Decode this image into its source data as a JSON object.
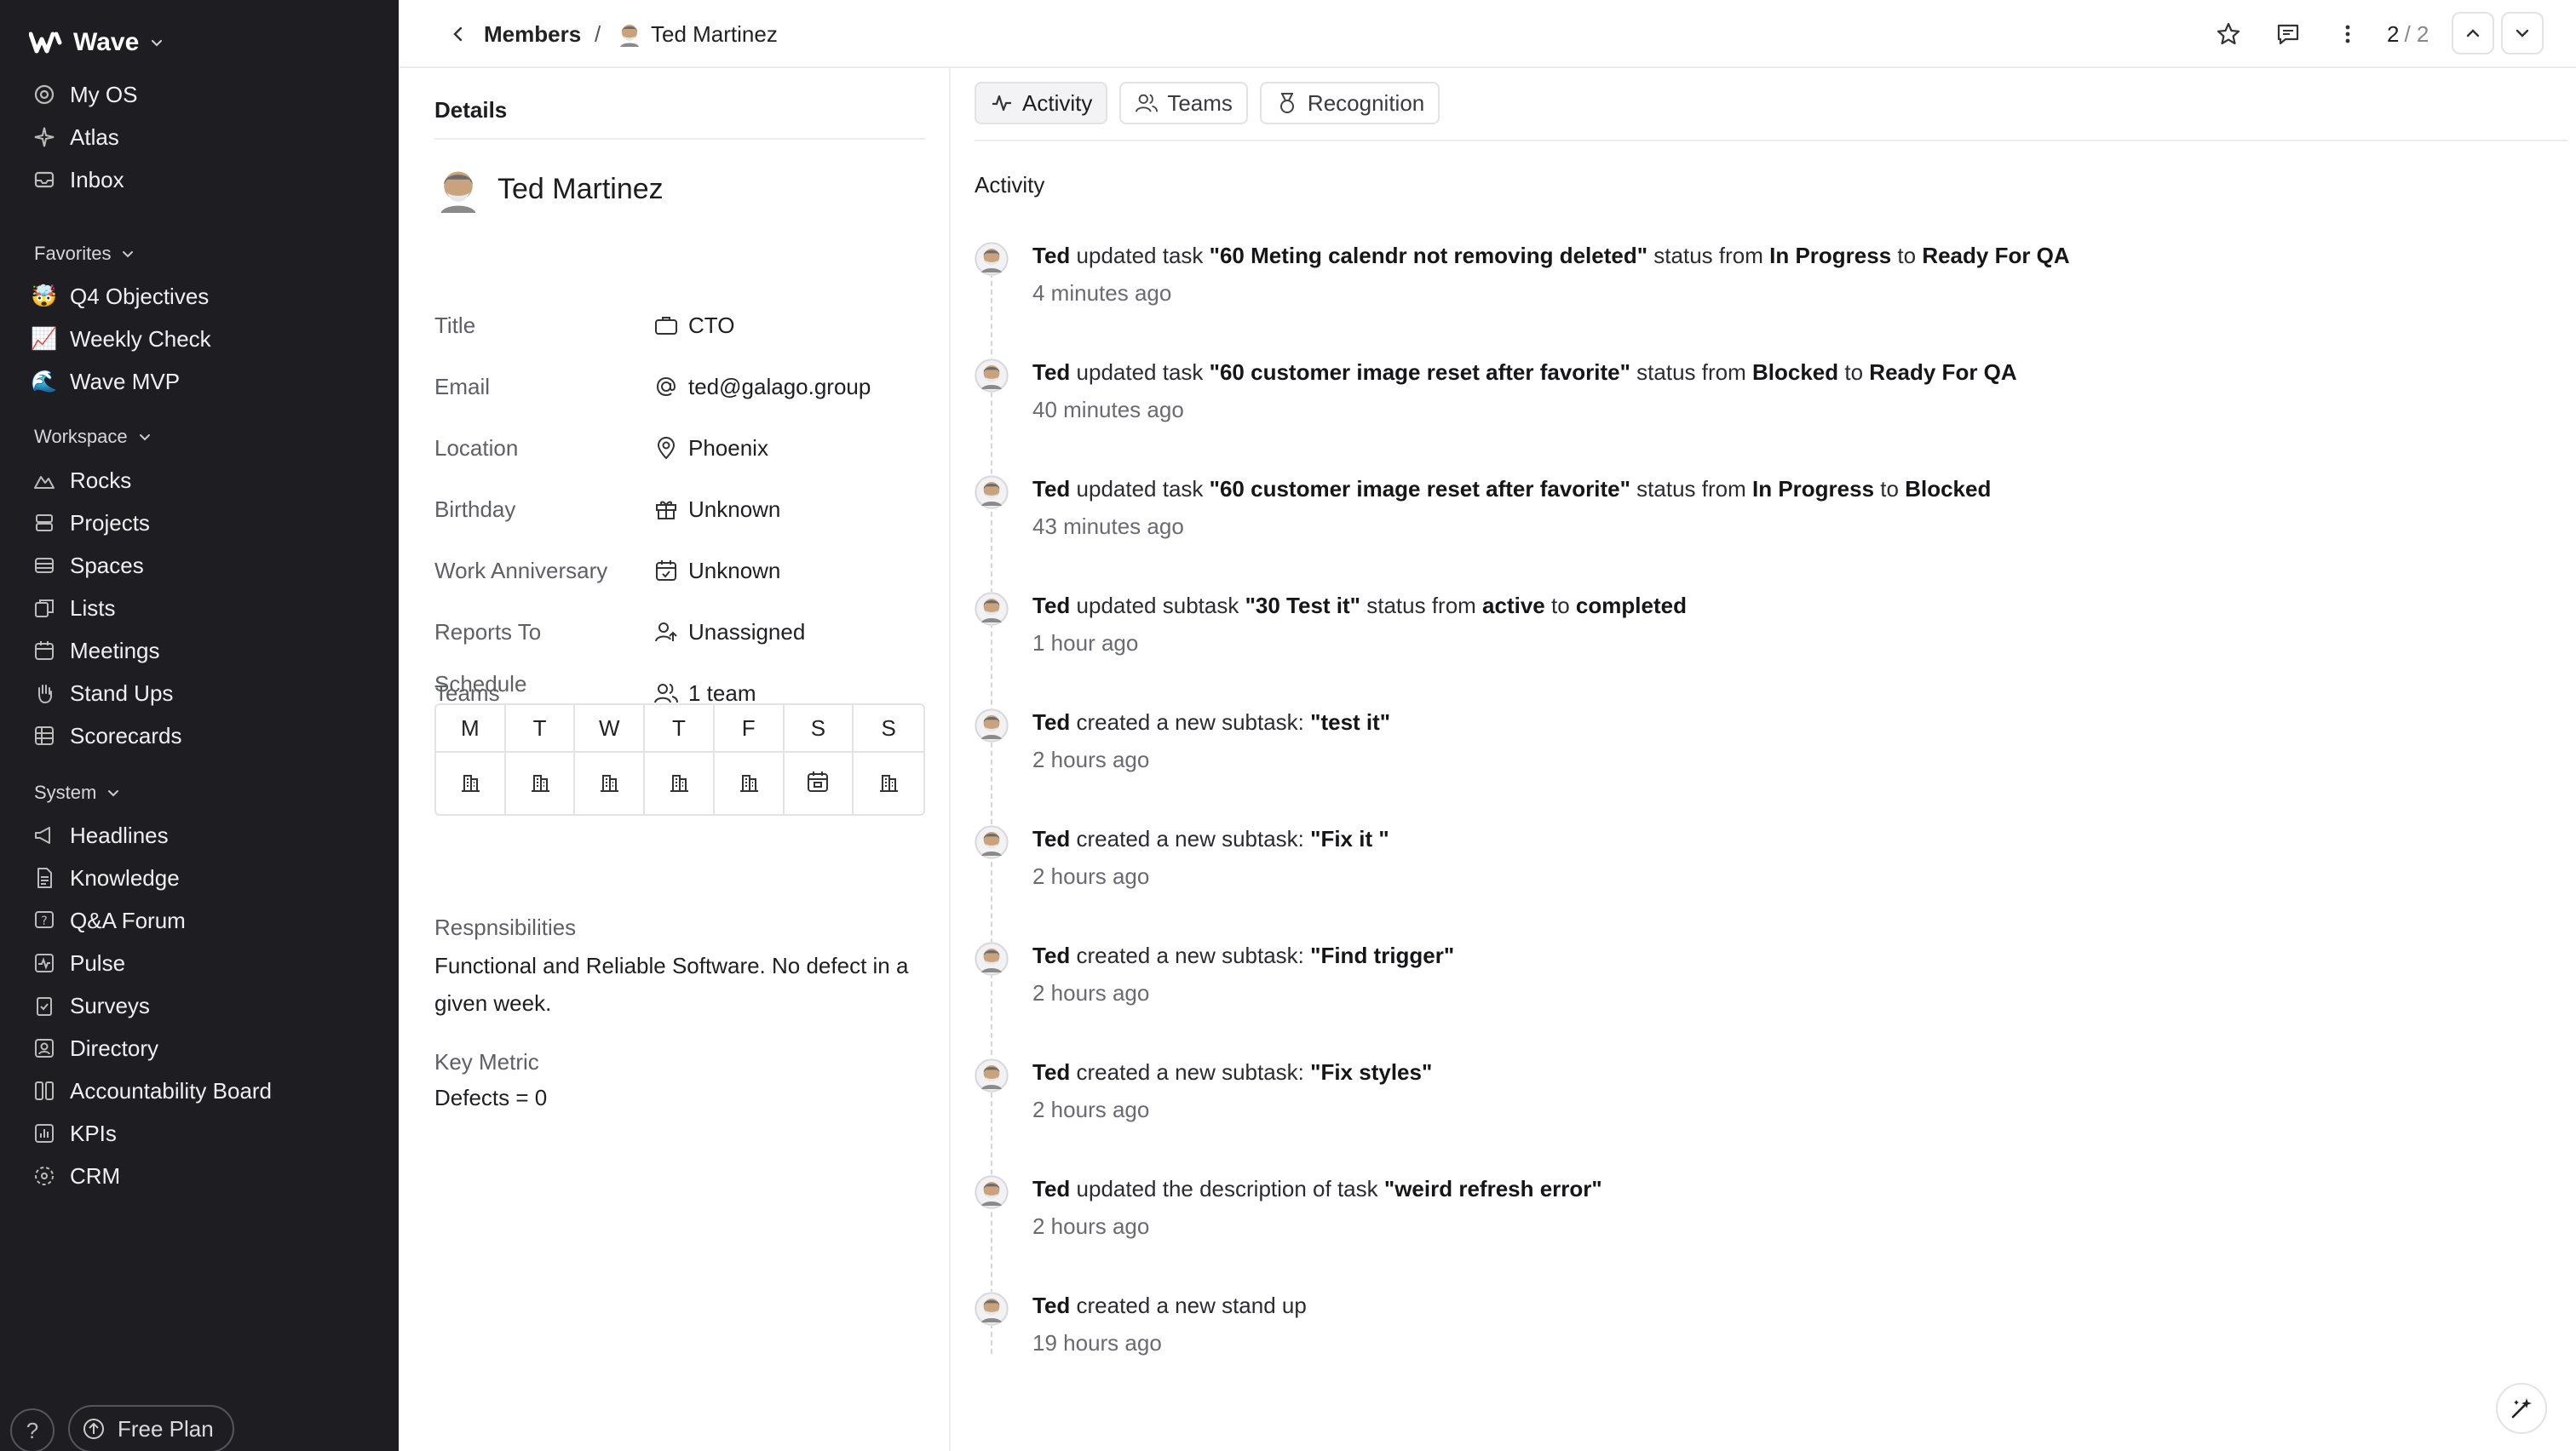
{
  "app": {
    "name": "Wave"
  },
  "sidebar": {
    "top_items": [
      {
        "label": "My OS",
        "icon": "target-icon"
      },
      {
        "label": "Atlas",
        "icon": "sparkle-icon"
      },
      {
        "label": "Inbox",
        "icon": "inbox-icon"
      }
    ],
    "favorites": {
      "label": "Favorites",
      "items": [
        {
          "label": "Q4 Objectives",
          "emoji": "🤯"
        },
        {
          "label": "Weekly Check",
          "emoji": "📈"
        },
        {
          "label": "Wave MVP",
          "emoji": "🌊"
        }
      ]
    },
    "workspace": {
      "label": "Workspace",
      "items": [
        {
          "label": "Rocks",
          "icon": "rocks-icon"
        },
        {
          "label": "Projects",
          "icon": "projects-icon"
        },
        {
          "label": "Spaces",
          "icon": "spaces-icon"
        },
        {
          "label": "Lists",
          "icon": "lists-icon"
        },
        {
          "label": "Meetings",
          "icon": "calendar-icon"
        },
        {
          "label": "Stand Ups",
          "icon": "hand-icon"
        },
        {
          "label": "Scorecards",
          "icon": "grid-icon"
        }
      ]
    },
    "system": {
      "label": "System",
      "items": [
        {
          "label": "Headlines",
          "icon": "megaphone-icon"
        },
        {
          "label": "Knowledge",
          "icon": "document-icon"
        },
        {
          "label": "Q&A Forum",
          "icon": "question-icon"
        },
        {
          "label": "Pulse",
          "icon": "pulse-icon"
        },
        {
          "label": "Surveys",
          "icon": "clipboard-icon"
        },
        {
          "label": "Directory",
          "icon": "contact-icon"
        },
        {
          "label": "Accountability Board",
          "icon": "columns-icon"
        },
        {
          "label": "KPIs",
          "icon": "chart-icon"
        },
        {
          "label": "CRM",
          "icon": "crm-icon"
        }
      ]
    },
    "footer": {
      "help": "?",
      "plan": "Free Plan"
    }
  },
  "topbar": {
    "breadcrumb": {
      "parent": "Members",
      "separator": "/",
      "current": "Ted Martinez"
    },
    "pager": {
      "current": "2",
      "total": "/ 2"
    }
  },
  "details": {
    "title": "Details",
    "name": "Ted Martinez",
    "fields": [
      {
        "label": "Title",
        "value": "CTO",
        "icon": "briefcase-icon"
      },
      {
        "label": "Email",
        "value": "ted@galago.group",
        "icon": "at-icon"
      },
      {
        "label": "Location",
        "value": "Phoenix",
        "icon": "pin-icon"
      },
      {
        "label": "Birthday",
        "value": "Unknown",
        "icon": "gift-icon"
      },
      {
        "label": "Work Anniversary",
        "value": "Unknown",
        "icon": "calendar-icon"
      },
      {
        "label": "Reports To",
        "value": "Unassigned",
        "icon": "user-arrow-icon"
      },
      {
        "label": "Teams",
        "value": "1 team",
        "icon": "users-icon"
      }
    ],
    "schedule": {
      "label": "Schedule",
      "days": [
        "M",
        "T",
        "W",
        "T",
        "F",
        "S",
        "S"
      ],
      "modes": [
        "office",
        "office",
        "office",
        "office",
        "office",
        "calendar",
        "office"
      ]
    },
    "responsibilities_label": "Respnsibilities",
    "responsibilities": "Functional and Reliable Software. No defect in a given week.",
    "key_metric_label": "Key Metric",
    "key_metric": "Defects = 0"
  },
  "tabs": [
    {
      "label": "Activity",
      "icon": "activity-icon"
    },
    {
      "label": "Teams",
      "icon": "users-icon"
    },
    {
      "label": "Recognition",
      "icon": "medal-icon"
    }
  ],
  "activity": {
    "title": "Activity",
    "items": [
      {
        "segments": [
          [
            "Ted",
            true
          ],
          [
            " updated task ",
            false
          ],
          [
            "\"60 Meting calendr not removing deleted\"",
            true
          ],
          [
            " status from ",
            false
          ],
          [
            "In Progress",
            true
          ],
          [
            " to ",
            false
          ],
          [
            "Ready For QA",
            true
          ]
        ],
        "time": "4 minutes ago"
      },
      {
        "segments": [
          [
            "Ted",
            true
          ],
          [
            " updated task ",
            false
          ],
          [
            "\"60 customer image reset after favorite\"",
            true
          ],
          [
            " status from ",
            false
          ],
          [
            "Blocked",
            true
          ],
          [
            " to ",
            false
          ],
          [
            "Ready For QA",
            true
          ]
        ],
        "time": "40 minutes ago"
      },
      {
        "segments": [
          [
            "Ted",
            true
          ],
          [
            " updated task ",
            false
          ],
          [
            "\"60 customer image reset after favorite\"",
            true
          ],
          [
            " status from ",
            false
          ],
          [
            "In Progress",
            true
          ],
          [
            " to ",
            false
          ],
          [
            "Blocked",
            true
          ]
        ],
        "time": "43 minutes ago"
      },
      {
        "segments": [
          [
            "Ted",
            true
          ],
          [
            " updated subtask ",
            false
          ],
          [
            "\"30 Test it\"",
            true
          ],
          [
            " status from ",
            false
          ],
          [
            "active",
            true
          ],
          [
            " to ",
            false
          ],
          [
            "completed",
            true
          ]
        ],
        "time": "1 hour ago"
      },
      {
        "segments": [
          [
            "Ted",
            true
          ],
          [
            " created a new subtask: ",
            false
          ],
          [
            "\"test it\"",
            true
          ]
        ],
        "time": "2 hours ago"
      },
      {
        "segments": [
          [
            "Ted",
            true
          ],
          [
            " created a new subtask: ",
            false
          ],
          [
            "\"Fix it \"",
            true
          ]
        ],
        "time": "2 hours ago"
      },
      {
        "segments": [
          [
            "Ted",
            true
          ],
          [
            " created a new subtask: ",
            false
          ],
          [
            "\"Find trigger\"",
            true
          ]
        ],
        "time": "2 hours ago"
      },
      {
        "segments": [
          [
            "Ted",
            true
          ],
          [
            " created a new subtask: ",
            false
          ],
          [
            "\"Fix styles\"",
            true
          ]
        ],
        "time": "2 hours ago"
      },
      {
        "segments": [
          [
            "Ted",
            true
          ],
          [
            " updated the description of task ",
            false
          ],
          [
            "\"weird refresh error\"",
            true
          ]
        ],
        "time": "2 hours ago"
      },
      {
        "segments": [
          [
            "Ted",
            true
          ],
          [
            " created a new stand up",
            false
          ]
        ],
        "time": "19 hours ago"
      }
    ]
  }
}
